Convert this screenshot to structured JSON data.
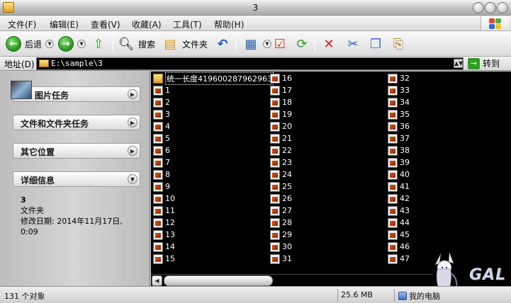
{
  "window": {
    "title": "3"
  },
  "menu": [
    "文件(F)",
    "编辑(E)",
    "查看(V)",
    "收藏(A)",
    "工具(T)",
    "帮助(H)"
  ],
  "toolbar": {
    "back_label": "后退",
    "search_label": "搜索",
    "folders_label": "文件夹"
  },
  "address": {
    "label": "地址(D)",
    "path": "E:\\sample\\3",
    "go_label": "转到"
  },
  "tasks": {
    "groups": [
      {
        "label": "图片任务"
      },
      {
        "label": "文件和文件夹任务"
      },
      {
        "label": "其它位置"
      },
      {
        "label": "详细信息"
      }
    ],
    "details": {
      "name": "3",
      "type": "文件夹",
      "modified": "修改日期: 2014年11月17日, 0:09"
    }
  },
  "files": {
    "columns": [
      [
        "统一长度419600287962963",
        "1",
        "2",
        "3",
        "4",
        "5",
        "6",
        "7",
        "8",
        "9",
        "10",
        "11",
        "12",
        "13",
        "14",
        "15"
      ],
      [
        "16",
        "17",
        "18",
        "19",
        "20",
        "21",
        "22",
        "23",
        "24",
        "25",
        "26",
        "27",
        "28",
        "29",
        "30",
        "31"
      ],
      [
        "32",
        "33",
        "34",
        "35",
        "36",
        "37",
        "38",
        "39",
        "40",
        "41",
        "42",
        "43",
        "44",
        "45",
        "46",
        "47"
      ]
    ]
  },
  "status": {
    "objects": "131 个对象",
    "size": "25.6 MB",
    "location": "我的电脑"
  },
  "watermark": {
    "text": "GAL"
  },
  "colors": {
    "file_bg": "#000000",
    "file_text": "#ffffff",
    "go_green": "#2f9e22"
  }
}
